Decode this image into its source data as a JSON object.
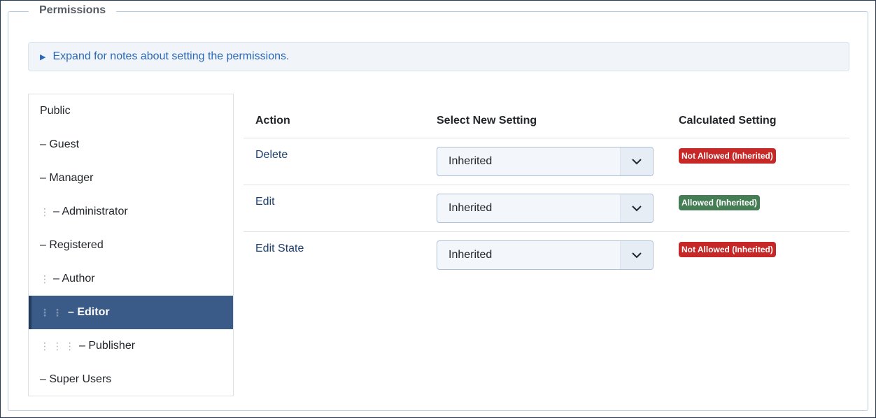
{
  "fieldset": {
    "legend": "Permissions"
  },
  "notes": {
    "label": "Expand for notes about setting the permissions."
  },
  "groups": [
    {
      "label": "Public",
      "depth": 0,
      "prefix": ""
    },
    {
      "label": "– Guest",
      "depth": 0,
      "prefix": ""
    },
    {
      "label": "– Manager",
      "depth": 0,
      "prefix": ""
    },
    {
      "label": "– Administrator",
      "depth": 1,
      "prefix": "⋮"
    },
    {
      "label": "– Registered",
      "depth": 0,
      "prefix": ""
    },
    {
      "label": "– Author",
      "depth": 1,
      "prefix": "⋮"
    },
    {
      "label": "– Editor",
      "depth": 2,
      "prefix": "⋮ ⋮",
      "active": true
    },
    {
      "label": "– Publisher",
      "depth": 3,
      "prefix": "⋮ ⋮ ⋮"
    },
    {
      "label": "– Super Users",
      "depth": 0,
      "prefix": ""
    }
  ],
  "table": {
    "headers": {
      "action": "Action",
      "select": "Select New Setting",
      "calculated": "Calculated Setting"
    },
    "rows": [
      {
        "action": "Delete",
        "setting": "Inherited",
        "calculated": "Not Allowed (Inherited)",
        "status": "denied"
      },
      {
        "action": "Edit",
        "setting": "Inherited",
        "calculated": "Allowed (Inherited)",
        "status": "allowed"
      },
      {
        "action": "Edit State",
        "setting": "Inherited",
        "calculated": "Not Allowed (Inherited)",
        "status": "denied"
      }
    ]
  },
  "colors": {
    "allowed": "#457d54",
    "denied": "#c52827",
    "active_bg": "#3a5a88",
    "link": "#2a69b8"
  },
  "icons": {
    "expand": "triangle-right-icon",
    "dropdown": "chevron-down-icon",
    "indent": "vertical-dots-icon"
  }
}
